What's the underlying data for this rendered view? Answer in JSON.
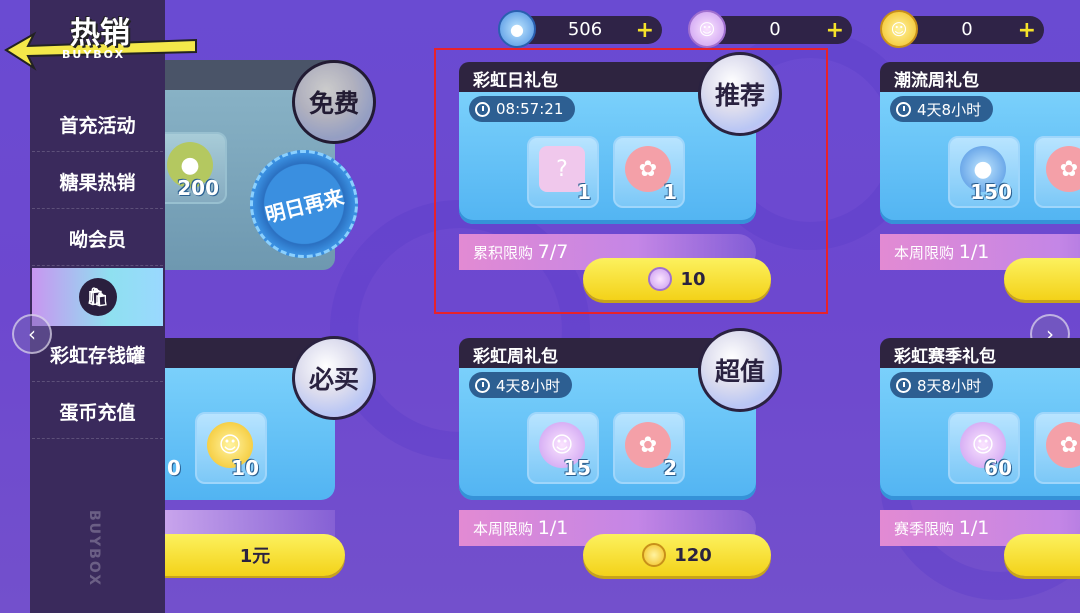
{
  "sidebar": {
    "title": "热销",
    "subtitle": "BUYBOX",
    "items": [
      {
        "label": "首充活动"
      },
      {
        "label": "糖果热销"
      },
      {
        "label": "呦会员"
      },
      {
        "label": ""
      },
      {
        "label": "彩虹存钱罐"
      },
      {
        "label": "蛋币充值"
      }
    ],
    "vertical_text": "BUYBOX"
  },
  "currency": [
    {
      "name": "blue-gem",
      "value": "506"
    },
    {
      "name": "purple-coin",
      "value": "0"
    },
    {
      "name": "yellow-coin",
      "value": "0"
    }
  ],
  "cards": {
    "free": {
      "badge": "免费",
      "count": "200",
      "stamp": "明日再来"
    },
    "must_buy": {
      "badge": "必买",
      "count_left": "0",
      "count": "10",
      "price": "1元"
    },
    "rainbow_day": {
      "title": "彩虹日礼包",
      "timer": "08:57:21",
      "badge": "推荐",
      "items": [
        "1",
        "1"
      ],
      "limit_label": "累积限购",
      "limit_value": "7/7",
      "price": "10"
    },
    "rainbow_week": {
      "title": "彩虹周礼包",
      "timer": "4天8小时",
      "badge": "超值",
      "items": [
        "15",
        "2"
      ],
      "limit_label": "本周限购",
      "limit_value": "1/1",
      "price": "120"
    },
    "trend_week": {
      "title": "潮流周礼包",
      "timer": "4天8小时",
      "items": [
        "150"
      ],
      "limit_label": "本周限购",
      "limit_value": "1/1"
    },
    "rainbow_season": {
      "title": "彩虹赛季礼包",
      "timer": "8天8小时",
      "items": [
        "60"
      ],
      "limit_label": "赛季限购",
      "limit_value": "1/1"
    }
  },
  "colors": {
    "highlight_box": "#e8222a",
    "price_button": "#f3d219",
    "card_blue": "#52b4f2"
  }
}
